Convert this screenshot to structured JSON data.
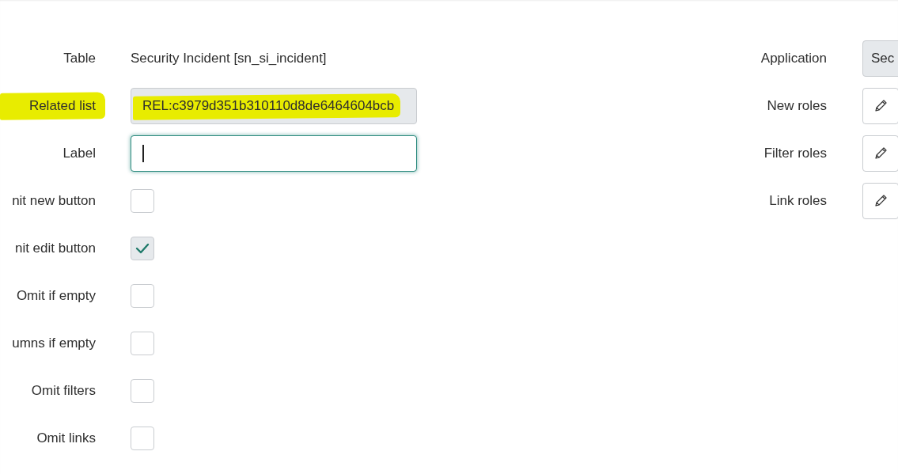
{
  "form": {
    "left_fields": [
      {
        "kind": "text",
        "label": "Table",
        "value": "Security Incident [sn_si_incident]",
        "highlighted": false
      },
      {
        "kind": "readonly",
        "label": "Related list",
        "value": "REL:c3979d351b310110d8de6464604bcb",
        "highlighted": true
      },
      {
        "kind": "input",
        "label": "Label",
        "focused": true,
        "highlighted": false
      },
      {
        "kind": "checkbox",
        "label": "nit new button",
        "checked": false,
        "highlighted": false
      },
      {
        "kind": "checkbox",
        "label": "nit edit button",
        "checked": true,
        "highlighted": false
      },
      {
        "kind": "checkbox",
        "label": "Omit if empty",
        "checked": false,
        "highlighted": false
      },
      {
        "kind": "checkbox",
        "label": "umns if empty",
        "checked": false,
        "highlighted": false
      },
      {
        "kind": "checkbox",
        "label": "Omit filters",
        "checked": false,
        "highlighted": false
      },
      {
        "kind": "checkbox",
        "label": "Omit links",
        "checked": false,
        "highlighted": false
      }
    ],
    "right_fields": [
      {
        "kind": "readonly",
        "label": "Application",
        "value": "Sec"
      },
      {
        "kind": "edit",
        "label": "New roles"
      },
      {
        "kind": "edit",
        "label": "Filter roles"
      },
      {
        "kind": "edit",
        "label": "Link roles"
      }
    ]
  }
}
